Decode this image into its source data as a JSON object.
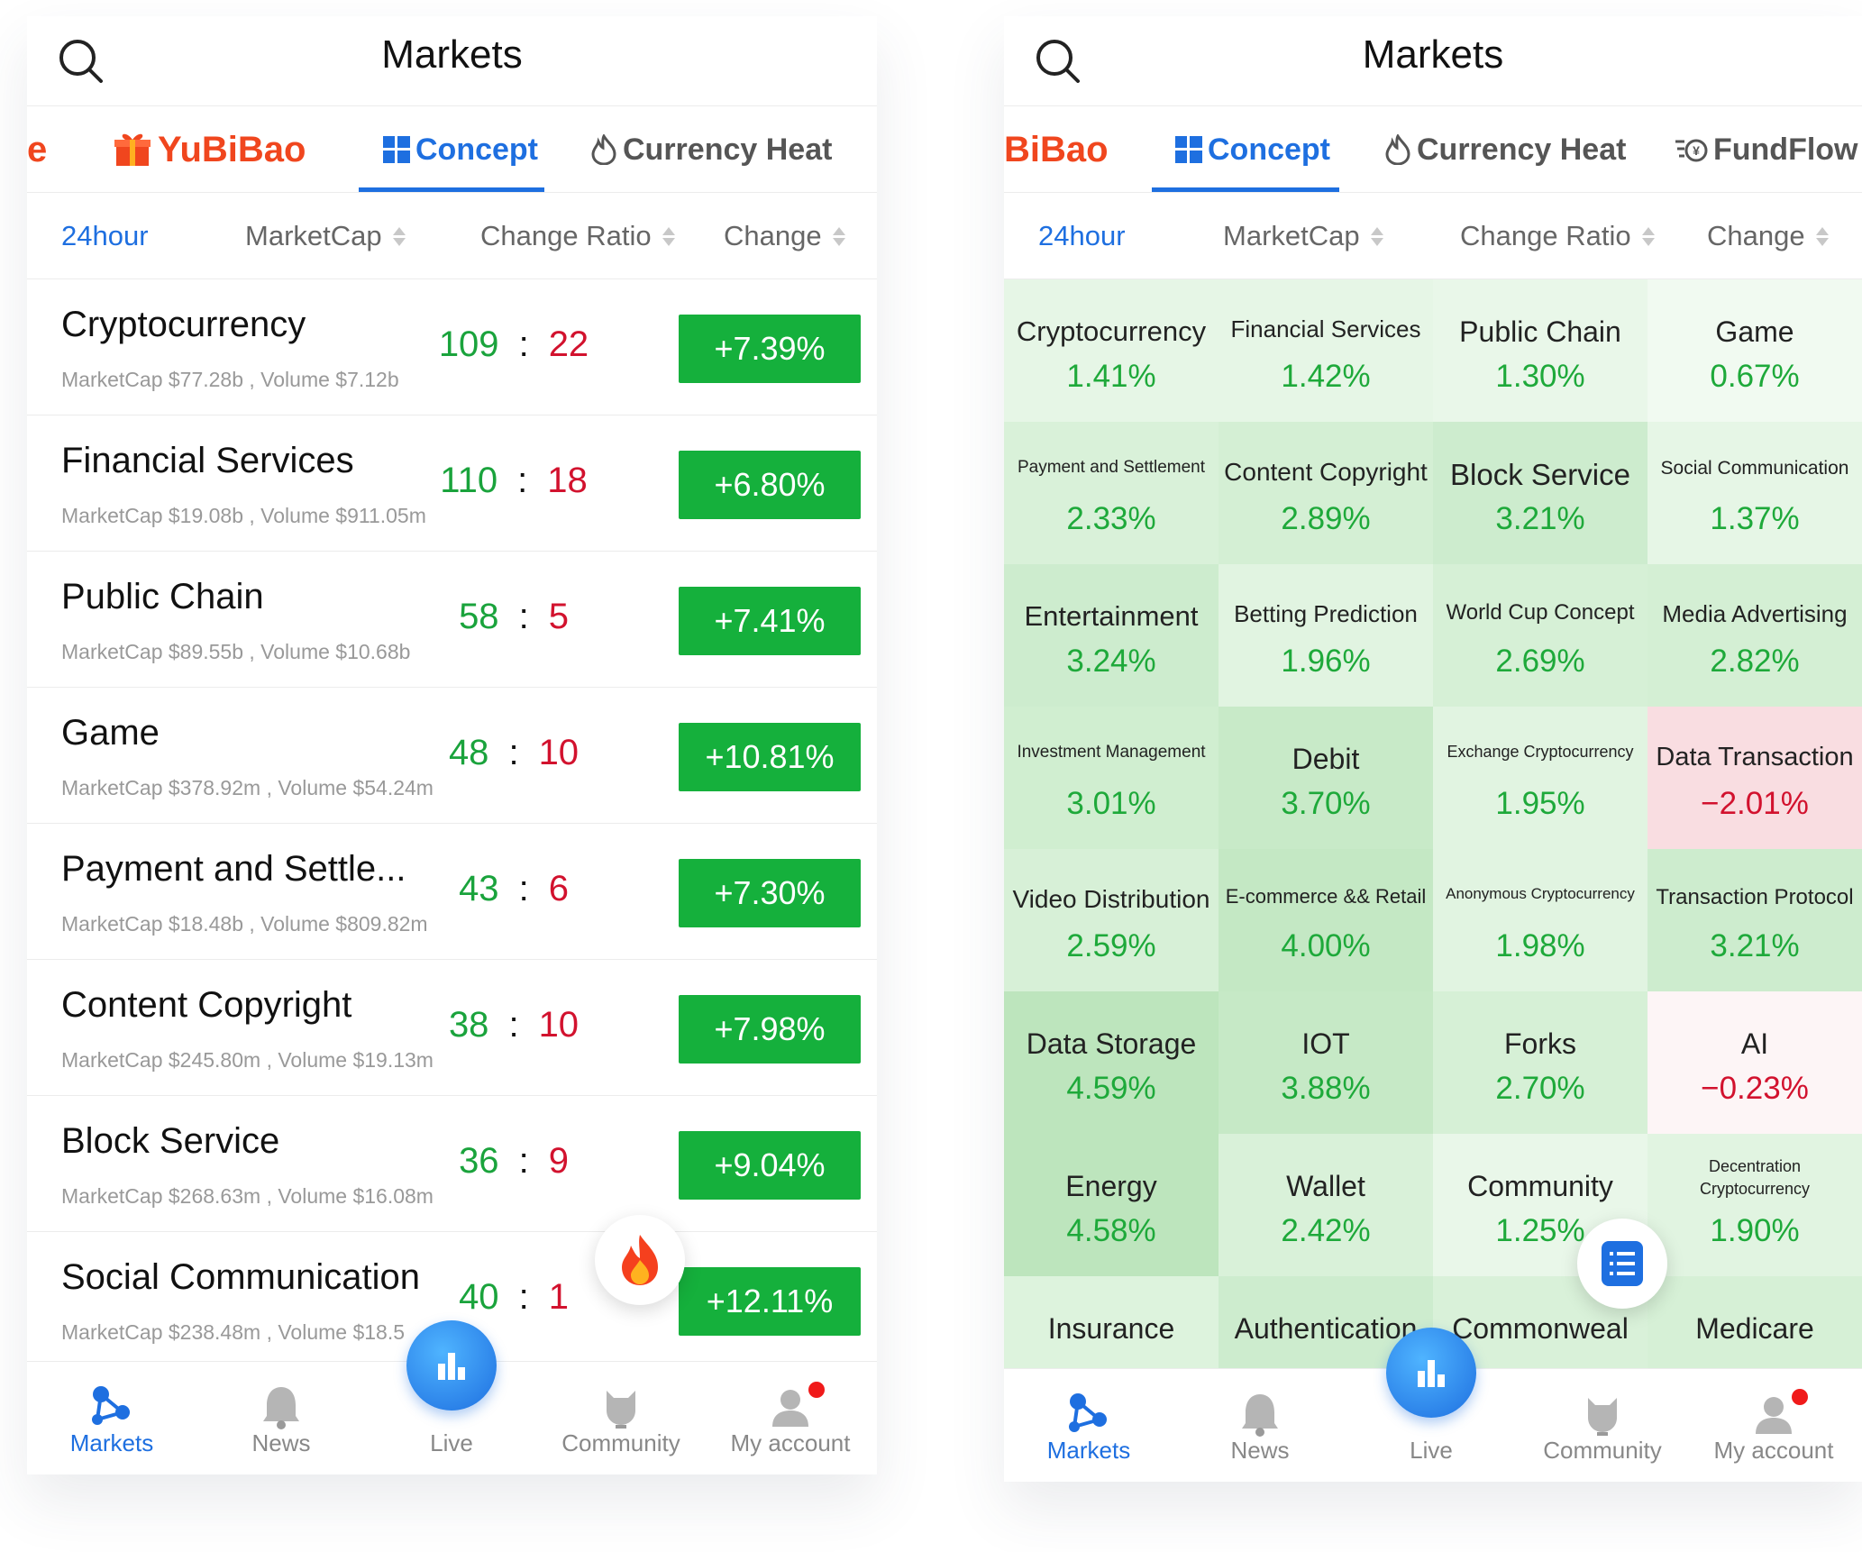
{
  "left": {
    "title": "Markets",
    "tabs": {
      "prev": "e",
      "yubibao": "YuBiBao",
      "concept": "Concept",
      "heat": "Currency Heat"
    },
    "sort": {
      "period": "24hour",
      "marketcap": "MarketCap",
      "ratio": "Change Ratio",
      "change": "Change"
    },
    "rows": [
      {
        "name": "Cryptocurrency",
        "sub": "MarketCap $77.28b , Volume $7.12b",
        "up": "109",
        "down": "22",
        "change": "+7.39%"
      },
      {
        "name": "Financial Services",
        "sub": "MarketCap $19.08b , Volume $911.05m",
        "up": "110",
        "down": "18",
        "change": "+6.80%"
      },
      {
        "name": "Public Chain",
        "sub": "MarketCap $89.55b , Volume $10.68b",
        "up": "58",
        "down": "5",
        "change": "+7.41%"
      },
      {
        "name": "Game",
        "sub": "MarketCap $378.92m , Volume $54.24m",
        "up": "48",
        "down": "10",
        "change": "+10.81%"
      },
      {
        "name": "Payment and Settle...",
        "sub": "MarketCap $18.48b , Volume $809.82m",
        "up": "43",
        "down": "6",
        "change": "+7.30%"
      },
      {
        "name": "Content Copyright",
        "sub": "MarketCap $245.80m , Volume $19.13m",
        "up": "38",
        "down": "10",
        "change": "+7.98%"
      },
      {
        "name": "Block Service",
        "sub": "MarketCap $268.63m , Volume $16.08m",
        "up": "36",
        "down": "9",
        "change": "+9.04%"
      },
      {
        "name": "Social Communication",
        "sub": "MarketCap $238.48m , Volume $18.5",
        "up": "40",
        "down": "1",
        "change": "+12.11%"
      }
    ],
    "nav": {
      "markets": "Markets",
      "news": "News",
      "live": "Live",
      "community": "Community",
      "account": "My account"
    }
  },
  "right": {
    "title": "Markets",
    "tabs": {
      "yubibao": "BiBao",
      "concept": "Concept",
      "heat": "Currency Heat",
      "fundflow": "FundFlow"
    },
    "sort": {
      "period": "24hour",
      "marketcap": "MarketCap",
      "ratio": "Change Ratio",
      "change": "Change"
    },
    "cells": [
      {
        "name": "Cryptocurrency",
        "value": "1.41%",
        "bg": "#e6f6e6",
        "size": "31px"
      },
      {
        "name": "Financial Services",
        "value": "1.42%",
        "bg": "#e6f6e6",
        "size": "26px"
      },
      {
        "name": "Public Chain",
        "value": "1.30%",
        "bg": "#e9f7e9",
        "size": "32px"
      },
      {
        "name": "Game",
        "value": "0.67%",
        "bg": "#f1faf1",
        "size": "32px"
      },
      {
        "name": "Payment and Settlement",
        "value": "2.33%",
        "bg": "#d9f1d9",
        "size": "19px"
      },
      {
        "name": "Content Copyright",
        "value": "2.89%",
        "bg": "#d4efd4",
        "size": "28px"
      },
      {
        "name": "Block Service",
        "value": "3.21%",
        "bg": "#cdecce",
        "size": "33px"
      },
      {
        "name": "Social Communication",
        "value": "1.37%",
        "bg": "#e6f6e6",
        "size": "21px"
      },
      {
        "name": "Entertainment",
        "value": "3.24%",
        "bg": "#cdecce",
        "size": "31px"
      },
      {
        "name": "Betting Prediction",
        "value": "1.96%",
        "bg": "#e1f4e1",
        "size": "26px"
      },
      {
        "name": "World Cup Concept",
        "value": "2.69%",
        "bg": "#d6f0d6",
        "size": "24px"
      },
      {
        "name": "Media Advertising",
        "value": "2.82%",
        "bg": "#d4efd4",
        "size": "26px"
      },
      {
        "name": "Investment Management",
        "value": "3.01%",
        "bg": "#d0eed0",
        "size": "19px"
      },
      {
        "name": "Debit",
        "value": "3.70%",
        "bg": "#c8eac8",
        "size": "32px"
      },
      {
        "name": "Exchange Cryptocurrency",
        "value": "1.95%",
        "bg": "#e1f4e1",
        "size": "18px"
      },
      {
        "name": "Data Transaction",
        "value": "−2.01%",
        "bg": "#f9dde1",
        "size": "29px",
        "neg": true
      },
      {
        "name": "Video Distribution",
        "value": "2.59%",
        "bg": "#d7f0d7",
        "size": "28px"
      },
      {
        "name": "E-commerce && Retail",
        "value": "4.00%",
        "bg": "#c4e8c4",
        "size": "22px"
      },
      {
        "name": "Anonymous Cryptocurrency",
        "value": "1.98%",
        "bg": "#e1f4e1",
        "size": "17px"
      },
      {
        "name": "Transaction Protocol",
        "value": "3.21%",
        "bg": "#cdecce",
        "size": "24px"
      },
      {
        "name": "Data Storage",
        "value": "4.59%",
        "bg": "#bde5bd",
        "size": "32px"
      },
      {
        "name": "IOT",
        "value": "3.88%",
        "bg": "#c6e9c6",
        "size": "32px"
      },
      {
        "name": "Forks",
        "value": "2.70%",
        "bg": "#d6f0d6",
        "size": "32px"
      },
      {
        "name": "AI",
        "value": "−0.23%",
        "bg": "#fdf5f6",
        "size": "32px",
        "neg": true
      },
      {
        "name": "Energy",
        "value": "4.58%",
        "bg": "#bde5bd",
        "size": "32px"
      },
      {
        "name": "Wallet",
        "value": "2.42%",
        "bg": "#d9f1d9",
        "size": "32px"
      },
      {
        "name": "Community",
        "value": "1.25%",
        "bg": "#e9f7e9",
        "size": "32px"
      },
      {
        "name": "Decentration Cryptocurrency",
        "value": "1.90%",
        "bg": "#e1f4e1",
        "size": "18px"
      },
      {
        "name": "Insurance",
        "value": "",
        "bg": "#ddf3dd",
        "size": "32px"
      },
      {
        "name": "Authentication",
        "value": "",
        "bg": "#cdecce",
        "size": "32px"
      },
      {
        "name": "Commonweal",
        "value": "",
        "bg": "#d9f1d9",
        "size": "32px"
      },
      {
        "name": "Medicare",
        "value": "",
        "bg": "#d6f0d6",
        "size": "32px"
      }
    ],
    "nav": {
      "markets": "Markets",
      "news": "News",
      "live": "Live",
      "community": "Community",
      "account": "My account"
    }
  }
}
